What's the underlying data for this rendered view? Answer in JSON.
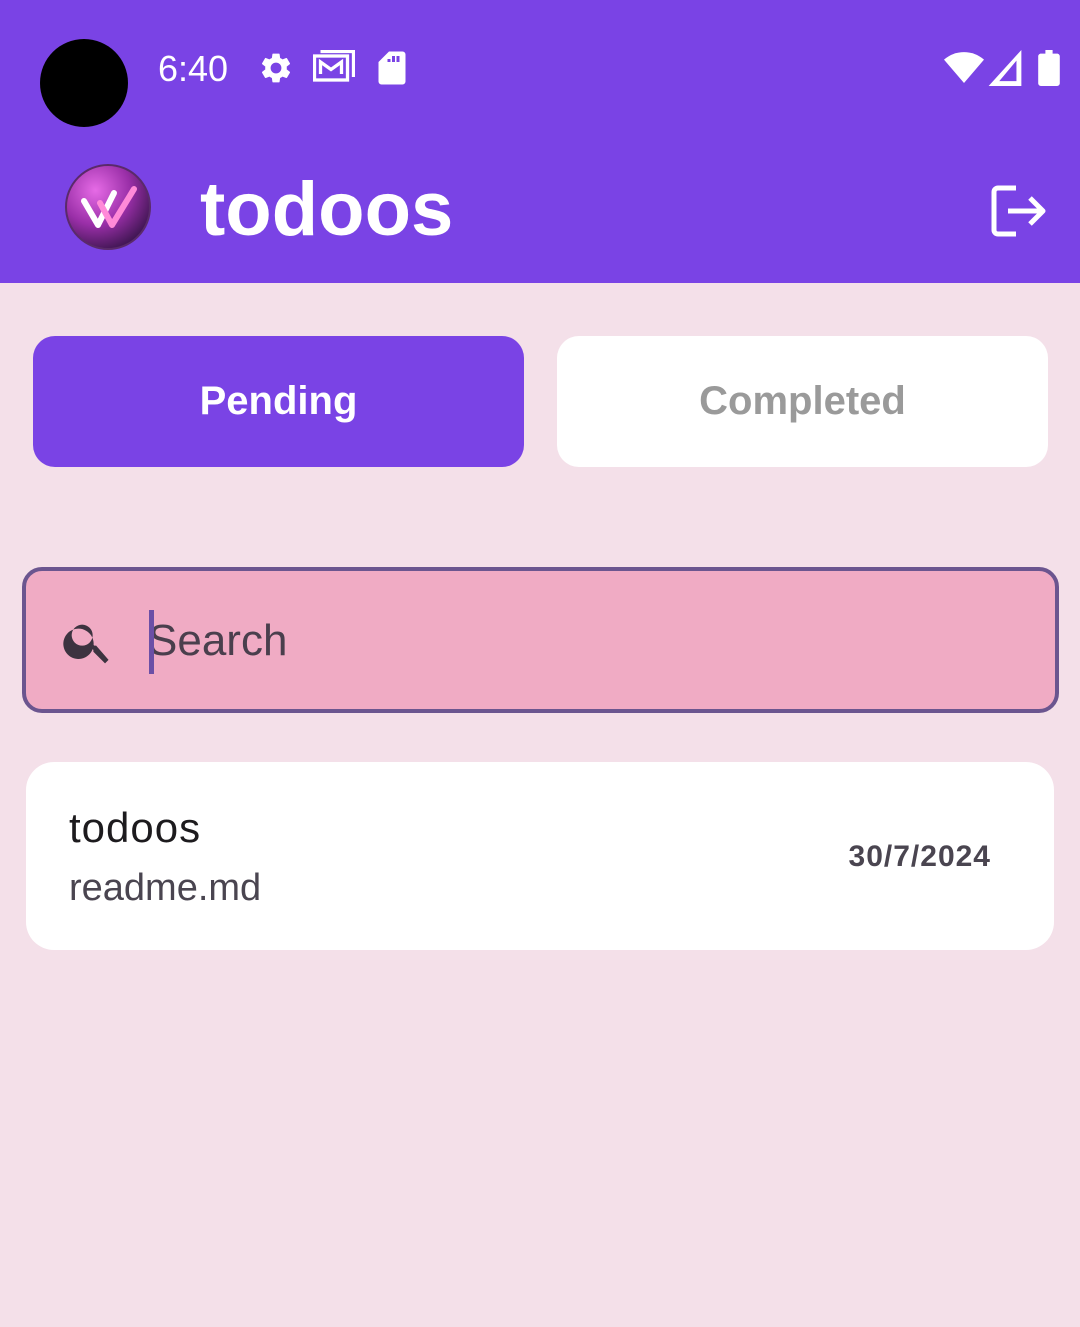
{
  "status_bar": {
    "time": "6:40",
    "left_icons": [
      "gear-icon",
      "gallery-mail-icon",
      "sd-card-icon"
    ],
    "right_icons": [
      "wifi-icon",
      "signal-icon",
      "battery-icon"
    ]
  },
  "app_bar": {
    "title": "todoos",
    "logo": "todoos-logo-icon",
    "action_icon": "logout-icon"
  },
  "tabs": [
    {
      "label": "Pending",
      "active": true
    },
    {
      "label": "Completed",
      "active": false
    }
  ],
  "search": {
    "placeholder": "Search",
    "value": "",
    "icon": "search-icon"
  },
  "todos": [
    {
      "title": "todoos",
      "subtitle": "readme.md",
      "date": "30/7/2024"
    }
  ],
  "colors": {
    "primary": "#7a43e5",
    "background": "#f4e0e9",
    "search_fill": "#f0abc4",
    "search_border": "#6b558f",
    "card": "#ffffff"
  }
}
